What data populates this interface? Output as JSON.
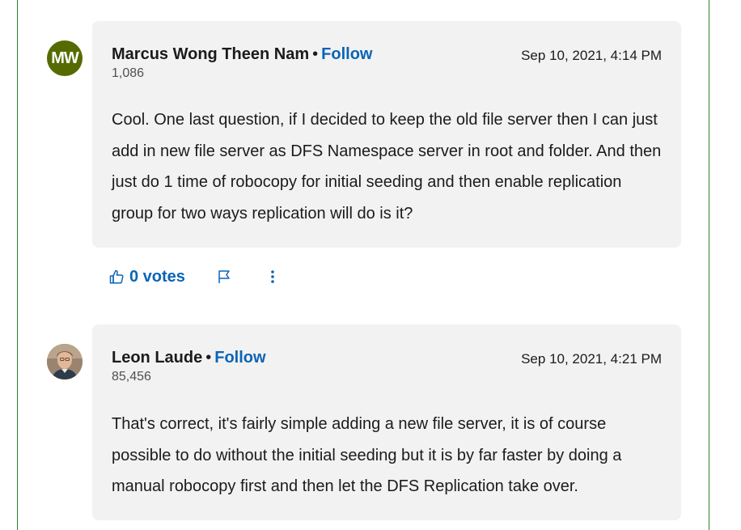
{
  "answers": [
    {
      "avatar_initials": "MW",
      "avatar_color": "#556b00",
      "author": "Marcus Wong Theen Nam",
      "separator": "•",
      "follow_label": "Follow",
      "points": "1,086",
      "timestamp": "Sep 10, 2021, 4:14 PM",
      "body": "Cool. One last question, if I decided to keep the old file server then I can just add in new file server as DFS Namespace server in root and folder. And then just do 1 time of robocopy for initial seeding and then enable replication group for two ways replication will do is it?"
    },
    {
      "author": "Leon Laude",
      "separator": "•",
      "follow_label": "Follow",
      "points": "85,456",
      "timestamp": "Sep 10, 2021, 4:21 PM",
      "body": "That's correct, it's fairly simple adding a new file server, it is of course possible to do without the initial seeding but it is by far faster by doing a manual robocopy first and then let the DFS Replication take over."
    }
  ],
  "actions": {
    "votes_label": "0 votes",
    "icons": [
      "thumbs-up-icon",
      "flag-icon",
      "more-vertical-icon"
    ]
  },
  "colors": {
    "accent": "#0b64b5",
    "card_background": "#f2f2f2",
    "frame_border": "#2e7d32"
  }
}
